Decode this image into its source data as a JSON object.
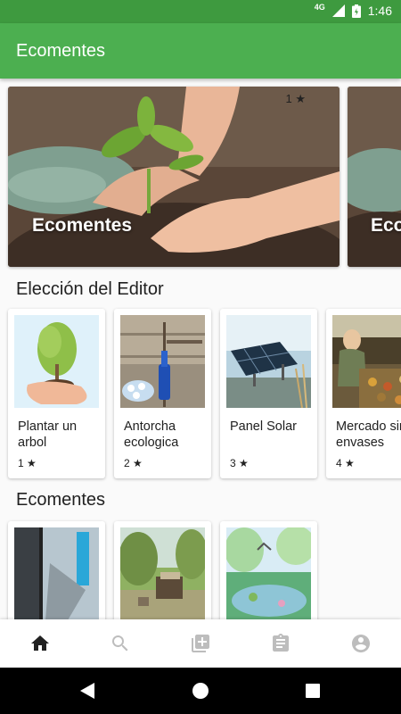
{
  "status_bar": {
    "network": "4G",
    "time": "1:46"
  },
  "app_bar": {
    "title": "Ecomentes"
  },
  "featured": [
    {
      "title": "Ecomentes",
      "rating": "1 ★"
    },
    {
      "title": "Ecomentes",
      "rating": ""
    }
  ],
  "sections": [
    {
      "title": "Elección del Editor",
      "cards": [
        {
          "name": "Plantar un arbol",
          "rating": "1 ★"
        },
        {
          "name": "Antorcha ecologica",
          "rating": "2 ★"
        },
        {
          "name": "Panel Solar",
          "rating": "3 ★"
        },
        {
          "name": "Mercado sin envases",
          "rating": "4 ★"
        }
      ]
    },
    {
      "title": "Ecomentes",
      "cards": [
        {
          "name": "",
          "rating": ""
        },
        {
          "name": "",
          "rating": ""
        },
        {
          "name": "",
          "rating": ""
        }
      ]
    }
  ],
  "bottom_nav": [
    {
      "icon": "home-icon",
      "active": true
    },
    {
      "icon": "search-icon",
      "active": false
    },
    {
      "icon": "add-library-icon",
      "active": false
    },
    {
      "icon": "clipboard-icon",
      "active": false
    },
    {
      "icon": "account-icon",
      "active": false
    }
  ],
  "colors": {
    "status_bar": "#3e9a3f",
    "app_bar": "#4caf50",
    "nav_active": "#212121",
    "nav_inactive": "#bdbdbd"
  }
}
